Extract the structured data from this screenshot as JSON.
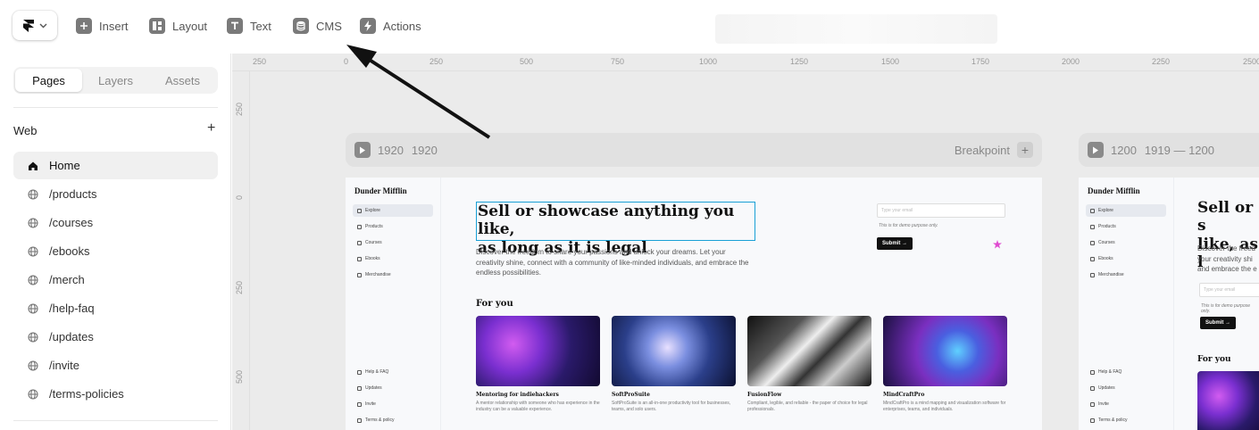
{
  "toolbar": {
    "items": [
      {
        "label": "Insert",
        "icon": "plus-square-icon"
      },
      {
        "label": "Layout",
        "icon": "layout-icon"
      },
      {
        "label": "Text",
        "icon": "text-icon"
      },
      {
        "label": "CMS",
        "icon": "database-icon"
      },
      {
        "label": "Actions",
        "icon": "bolt-icon"
      }
    ]
  },
  "sidebar": {
    "tabs": [
      "Pages",
      "Layers",
      "Assets"
    ],
    "active_tab": "Pages",
    "section_label": "Web",
    "add_label": "+",
    "pages": [
      "Home",
      "/products",
      "/courses",
      "/ebooks",
      "/merch",
      "/help-faq",
      "/updates",
      "/invite",
      "/terms-policies"
    ]
  },
  "canvas": {
    "ruler_top": [
      "250",
      "0",
      "250",
      "500",
      "750",
      "1000",
      "1250",
      "1500",
      "1750",
      "2000",
      "2250",
      "2500"
    ],
    "ruler_left": [
      "250",
      "0",
      "250",
      "500"
    ],
    "breakpoint1": {
      "width": "1920",
      "height": "1920",
      "label": "Breakpoint",
      "add": "+"
    },
    "breakpoint2": {
      "width": "1200",
      "range": "1919 — 1200"
    }
  },
  "site": {
    "brand": "Dunder Mifflin",
    "nav": [
      "Explore",
      "Products",
      "Courses",
      "Ebooks",
      "Merchandise"
    ],
    "nav_bottom": [
      "Help & FAQ",
      "Updates",
      "Invite",
      "Terms & policy"
    ],
    "hero_line1": "Sell or showcase anything you like,",
    "hero_line2": "as long as it is legal",
    "hero_short1": "Sell or s",
    "hero_short2": "like, as l",
    "description": "Discover the freedom to share your passions and unlock your dreams. Let your creativity shine, connect with a community of like-minded individuals, and embrace the endless possibilities.",
    "description_short": "Discover the freed your creativity shi and embrace the e",
    "email_placeholder": "Type your email",
    "demo_note": "This is for demo purpose only.",
    "submit_label": "Submit →",
    "for_you": "For you",
    "cards": [
      {
        "title": "Mentoring for indiehackers",
        "desc": "A mentor relationship with someone who has experience in the industry can be a valuable experience."
      },
      {
        "title": "SoftProSuite",
        "desc": "SoftProSuite is an all-in-one productivity tool for businesses, teams, and solo users."
      },
      {
        "title": "FusionFlow",
        "desc": "Compliant, legible, and reliable - the paper of choice for legal professionals."
      },
      {
        "title": "MindCraftPro",
        "desc": "MindCraftPro is a mind mapping and visualization software for enterprises, teams, and individuals."
      }
    ]
  }
}
